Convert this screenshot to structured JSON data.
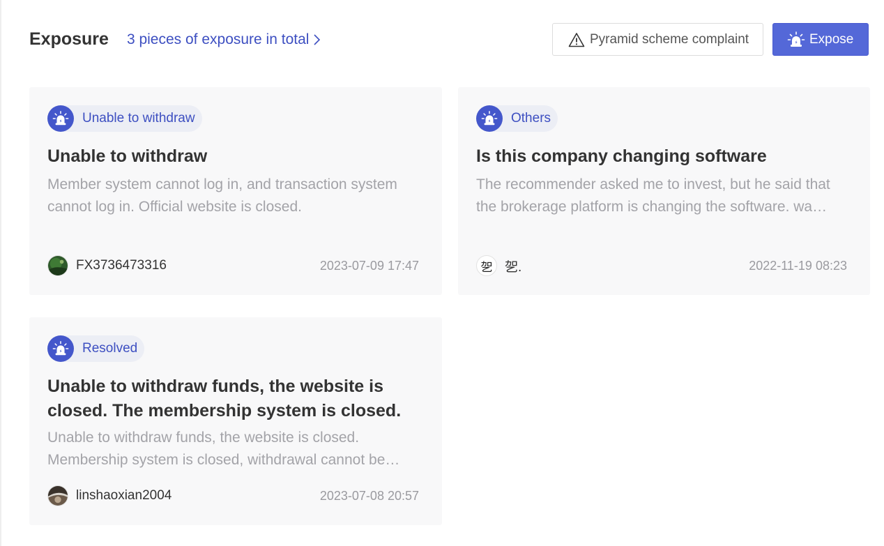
{
  "header": {
    "title": "Exposure",
    "total_link": "3 pieces of exposure in total",
    "complaint_button": "Pyramid scheme complaint",
    "expose_button": "Expose"
  },
  "colors": {
    "accent": "#4457cb",
    "button_primary": "#5468d8",
    "card_bg": "#f8f8f9",
    "muted_text": "#a3a3a8"
  },
  "cards": [
    {
      "tag": "Unable to withdraw",
      "title": "Unable to withdraw",
      "description": "Member system cannot log in, and transaction system cannot log in. Official website is closed.",
      "user": "FX3736473316",
      "time": "2023-07-09 17:47"
    },
    {
      "tag": "Others",
      "title": "Is this company changing software",
      "description": "The recommender asked me to invest, but he said that the brokerage platform is changing the software. wa…",
      "avatar_text": "乫",
      "user": "乫.",
      "time": "2022-11-19 08:23"
    },
    {
      "tag": "Resolved",
      "title": "Unable to withdraw funds, the website is closed. The membership system is closed.",
      "description": "Unable to withdraw funds, the website is closed. Membership system is closed, withdrawal cannot be…",
      "user": "linshaoxian2004",
      "time": "2023-07-08 20:57"
    }
  ],
  "icons": {
    "tag_badge": "alarm-siren-icon",
    "complaint": "warning-triangle-icon",
    "expose": "alarm-siren-icon",
    "more": "chevron-right-icon"
  }
}
